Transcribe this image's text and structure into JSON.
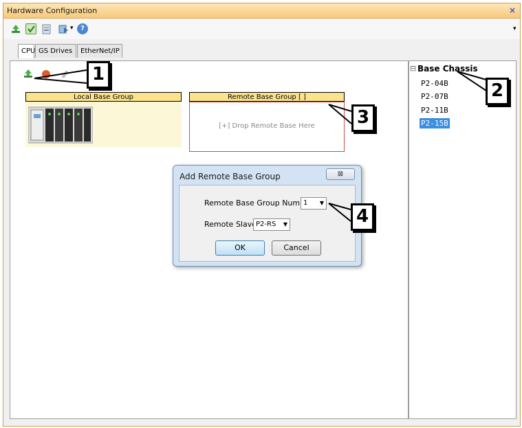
{
  "window": {
    "title": "Hardware Configuration",
    "close_glyph": "×"
  },
  "toolbar": {
    "overflow_glyph": "▾",
    "dropdown_glyph": "▾",
    "help_glyph": "?"
  },
  "tabs": [
    {
      "label": "CPU",
      "active": true
    },
    {
      "label": "GS Drives",
      "active": false
    },
    {
      "label": "EtherNet/IP",
      "active": false
    }
  ],
  "canvas": {
    "local_group": {
      "label": "Local Base Group"
    },
    "remote_group": {
      "label": "Remote Base Group [ ]",
      "drop_text": "[+] Drop Remote Base Here"
    }
  },
  "tree": {
    "root_label": "Base Chassis",
    "collapse_glyph": "⊟",
    "items": [
      "P2-04B",
      "P2-07B",
      "P2-11B",
      "P2-15B"
    ],
    "selected_index": 3
  },
  "dialog": {
    "title": "Add Remote Base Group",
    "close_glyph": "⊠",
    "group_number_label": "Remote Base Group Number",
    "group_number_value": "1",
    "slave_label": "Remote Slave",
    "slave_value": "P2-RS",
    "dropdown_glyph": "▼",
    "ok_label": "OK",
    "cancel_label": "Cancel"
  },
  "callouts": [
    "1",
    "2",
    "3",
    "4"
  ],
  "colors": {
    "accent": "#3a8de0",
    "group_header": "#fbe28c",
    "remote_border": "#d24a4a"
  }
}
